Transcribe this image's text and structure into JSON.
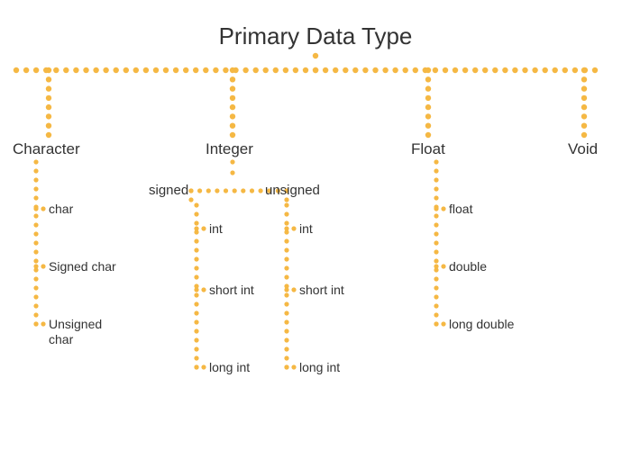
{
  "title": "Primary Data Type",
  "branches": {
    "character": {
      "label": "Character",
      "leaves": {
        "l0": "char",
        "l1": "Signed char",
        "l2": "Unsigned\nchar"
      }
    },
    "integer": {
      "label": "Integer",
      "signed": {
        "label": "signed",
        "leaves": {
          "l0": "int",
          "l1": "short int",
          "l2": "long int"
        }
      },
      "unsigned": {
        "label": "unsigned",
        "leaves": {
          "l0": "int",
          "l1": "short int",
          "l2": "long int"
        }
      }
    },
    "float": {
      "label": "Float",
      "leaves": {
        "l0": "float",
        "l1": "double",
        "l2": "long double"
      }
    },
    "void": {
      "label": "Void"
    }
  },
  "colors": {
    "dot": "#f5b844"
  }
}
